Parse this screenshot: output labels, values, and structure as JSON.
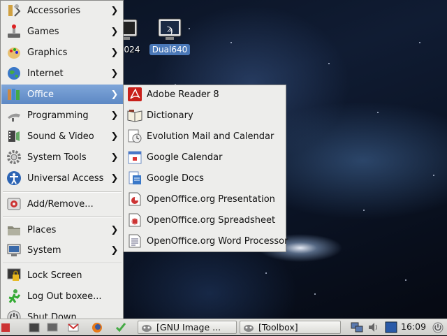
{
  "desktop": {
    "icons": [
      {
        "label": "024"
      },
      {
        "label": "Dual640"
      }
    ]
  },
  "main_menu": {
    "items": [
      {
        "label": "Accessories",
        "icon": "accessories-icon"
      },
      {
        "label": "Games",
        "icon": "games-icon"
      },
      {
        "label": "Graphics",
        "icon": "graphics-icon"
      },
      {
        "label": "Internet",
        "icon": "internet-icon"
      },
      {
        "label": "Office",
        "icon": "office-icon"
      },
      {
        "label": "Programming",
        "icon": "programming-icon"
      },
      {
        "label": "Sound & Video",
        "icon": "sound-video-icon"
      },
      {
        "label": "System Tools",
        "icon": "system-tools-icon"
      },
      {
        "label": "Universal Access",
        "icon": "universal-access-icon"
      },
      {
        "label": "Add/Remove...",
        "icon": "add-remove-icon"
      },
      {
        "label": "Places",
        "icon": "places-icon"
      },
      {
        "label": "System",
        "icon": "system-icon"
      },
      {
        "label": "Lock Screen",
        "icon": "lock-icon"
      },
      {
        "label": "Log Out boxee...",
        "icon": "logout-icon"
      },
      {
        "label": "Shut Down...",
        "icon": "power-icon"
      }
    ]
  },
  "office_menu": {
    "items": [
      {
        "label": "Adobe Reader 8",
        "icon": "adobe-reader-icon"
      },
      {
        "label": "Dictionary",
        "icon": "dictionary-icon"
      },
      {
        "label": "Evolution Mail and Calendar",
        "icon": "evolution-icon"
      },
      {
        "label": "Google Calendar",
        "icon": "google-calendar-icon"
      },
      {
        "label": "Google Docs",
        "icon": "google-docs-icon"
      },
      {
        "label": "OpenOffice.org Presentation",
        "icon": "presentation-icon"
      },
      {
        "label": "OpenOffice.org Spreadsheet",
        "icon": "spreadsheet-icon"
      },
      {
        "label": "OpenOffice.org Word Processor",
        "icon": "word-processor-icon"
      }
    ]
  },
  "taskbar": {
    "tasks": [
      {
        "label": "[GNU Image ..."
      },
      {
        "label": "[Toolbox]"
      }
    ],
    "clock": "16:09"
  },
  "colors": {
    "menu_bg": "#ededeb",
    "highlight": "#6b93cc",
    "adobe_red": "#c8201a"
  }
}
